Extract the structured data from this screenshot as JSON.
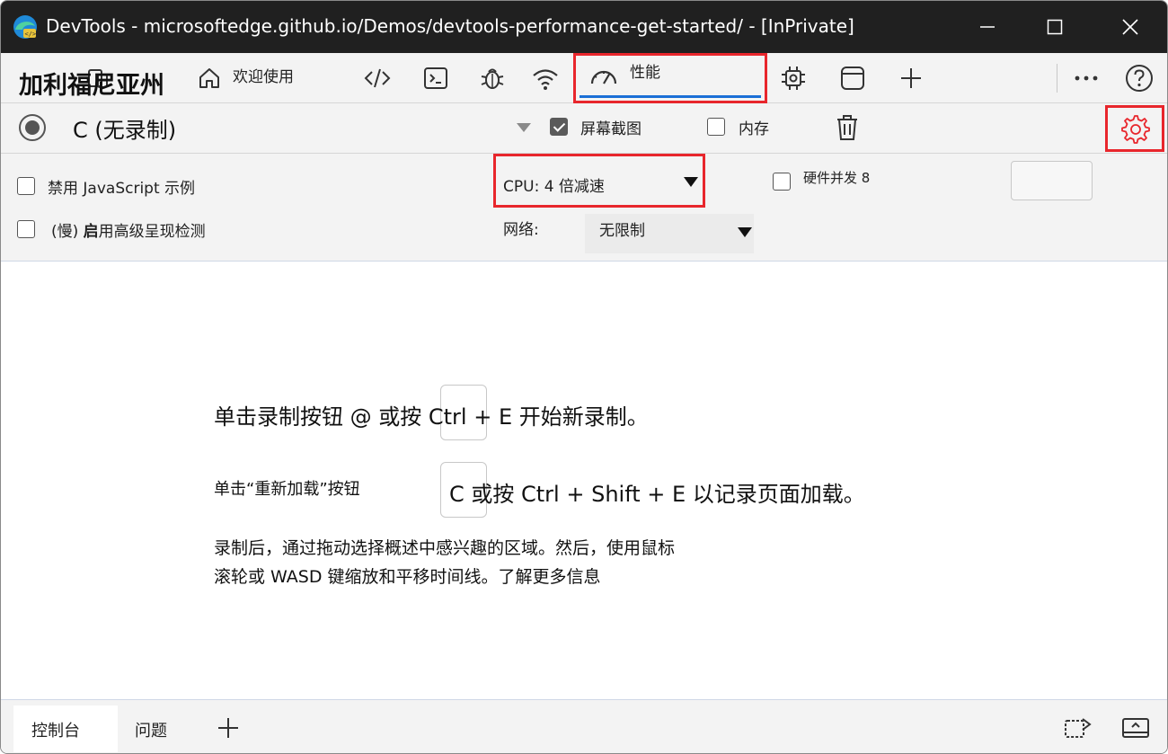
{
  "window": {
    "title": "DevTools - microsoftedge.github.io/Demos/devtools-performance-get-started/ - [InPrivate]"
  },
  "tabs": {
    "title": "加利福尼亚州",
    "welcome_label": "欢迎使用",
    "performance_label": "性能"
  },
  "recording": {
    "selected": "C (无录制)",
    "screenshots_label": "屏幕截图",
    "memory_label": "内存"
  },
  "settings": {
    "disable_js_samples": "禁用 JavaScript 示例",
    "enable_rendering_stats_prefix": "(慢)",
    "enable_rendering_stats_bold": "启",
    "enable_rendering_stats_rest": "用高级呈现检测",
    "cpu_label": "CPU: 4 倍减速",
    "hardware_concurrency_label": "硬件并发 8",
    "network_label": "网络:",
    "network_value": "无限制"
  },
  "instructions": {
    "line1": "单击录制按钮 @ 或按 Ctrl + E 开始新录制。",
    "line2_prefix": "单击“重新加载”按钮",
    "line2_suffix": "C 或按 Ctrl + Shift + E 以记录页面加载。",
    "line3": "录制后，通过拖动选择概述中感兴趣的区域。然后，使用鼠标",
    "line4": "滚轮或 WASD 键缩放和平移时间线。了解更多信息"
  },
  "drawer": {
    "console_label": "控制台",
    "issues_label": "问题"
  },
  "colors": {
    "highlight": "#e8262c",
    "tab_underline": "#1a6fd6",
    "titlebar": "#202020"
  }
}
